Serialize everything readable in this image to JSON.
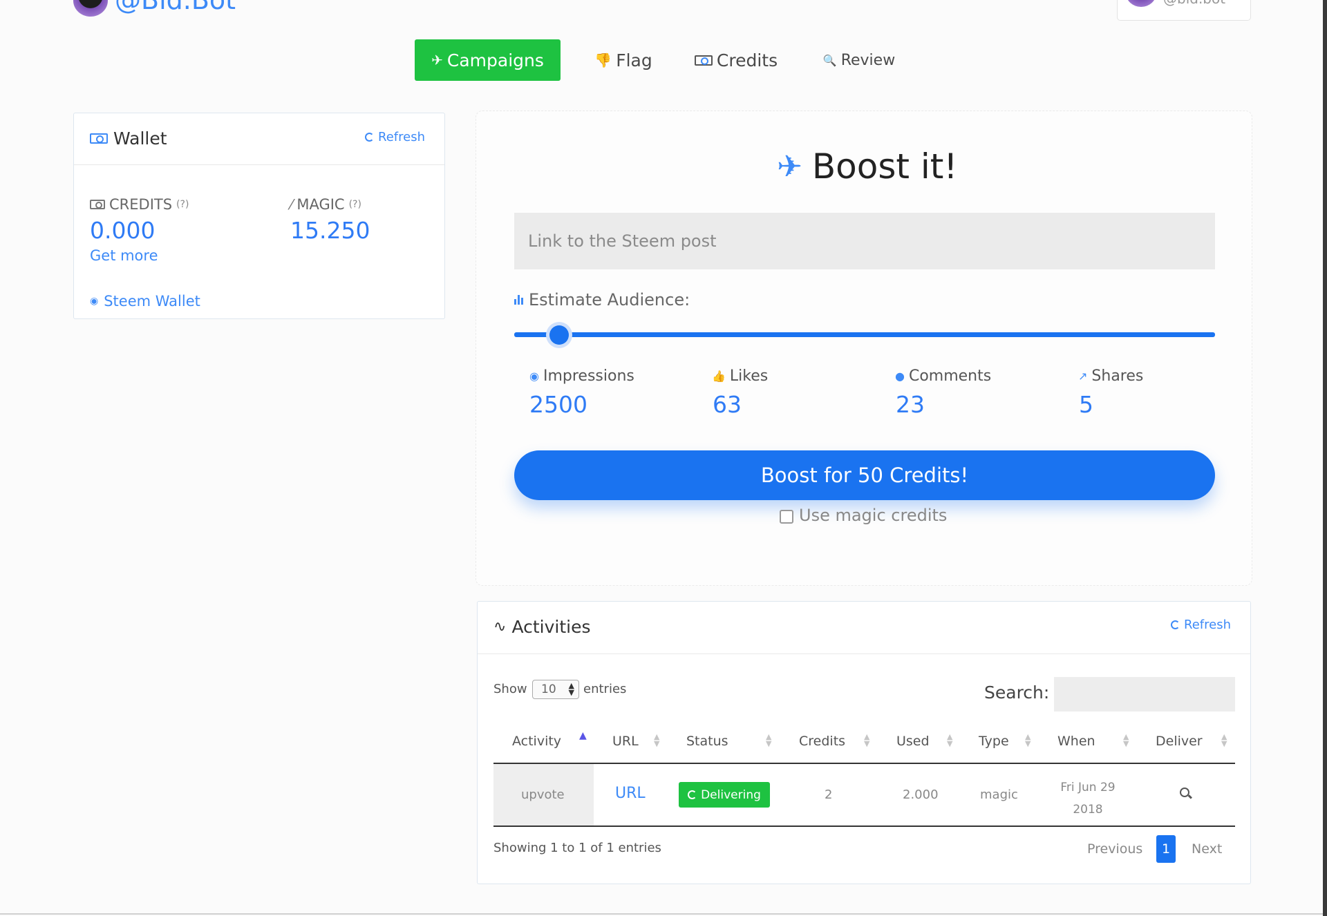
{
  "header": {
    "brand": "@Bid.Bot",
    "user": "@bid.bot"
  },
  "tabs": [
    {
      "label": "Campaigns",
      "icon": "jet-icon",
      "active": true
    },
    {
      "label": "Flag",
      "icon": "thumbs-down-icon"
    },
    {
      "label": "Credits",
      "icon": "money-icon"
    },
    {
      "label": "Review",
      "icon": "search-icon"
    }
  ],
  "wallet": {
    "title": "Wallet",
    "refresh": "Refresh",
    "credits_label": "CREDITS",
    "credits_help": "(?)",
    "credits_value": "0.000",
    "get_more": "Get more",
    "magic_label": "MAGIC",
    "magic_help": "(?)",
    "magic_value": "15.250",
    "steem_wallet": "Steem Wallet"
  },
  "boost": {
    "title": "Boost it!",
    "post_placeholder": "Link to the Steem post",
    "audience_label": "Estimate Audience:",
    "slider_level_percent": 5,
    "stats": [
      {
        "label": "Impressions",
        "value": "2500",
        "icon": "eye-icon"
      },
      {
        "label": "Likes",
        "value": "63",
        "icon": "thumbs-up-icon"
      },
      {
        "label": "Comments",
        "value": "23",
        "icon": "comment-icon"
      },
      {
        "label": "Shares",
        "value": "5",
        "icon": "share-icon"
      }
    ],
    "button": "Boost for 50 Credits!",
    "magic_checkbox": "Use magic credits",
    "accent": "#1a73f0"
  },
  "activities": {
    "title": "Activities",
    "refresh": "Refresh",
    "show": "Show",
    "page_length": "10",
    "entries": "entries",
    "search_label": "Search:",
    "columns": [
      "Activity",
      "URL",
      "Status",
      "Credits",
      "Used",
      "Type",
      "When",
      "Deliver"
    ],
    "rows": [
      {
        "activity": "upvote",
        "url": "URL",
        "status": "Delivering",
        "credits": "2",
        "used": "2.000",
        "type": "magic",
        "when_line1": "Fri Jun 29",
        "when_line2": "2018"
      }
    ],
    "info": "Showing 1 to 1 of 1 entries",
    "previous": "Previous",
    "current_page": "1",
    "next": "Next",
    "status_color": "#1ec241"
  }
}
